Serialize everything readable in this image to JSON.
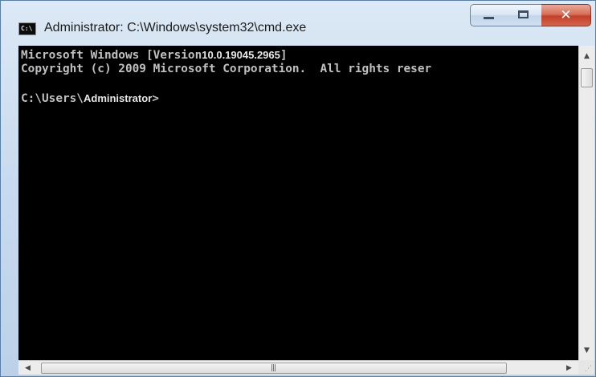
{
  "window": {
    "title": "Administrator: C:\\Windows\\system32\\cmd.exe",
    "icon_label": "C:\\",
    "buttons": {
      "minimize": "minimize-icon",
      "maximize": "maximize-icon",
      "close_glyph": "✕"
    }
  },
  "console": {
    "line1_prefix": "Microsoft Windows [Version",
    "line1_version": "10.0.19045.2965",
    "line1_suffix": "]",
    "line2": "Copyright (c) 2009 Microsoft Corporation.  All rights reser",
    "prompt_path": "C:\\Users\\",
    "prompt_user": "Administrator",
    "prompt_suffix": ">"
  },
  "scrollbars": {
    "up_arrow": "▲",
    "down_arrow": "▼",
    "left_arrow": "◀",
    "right_arrow": "▶",
    "grip": "|||",
    "size_grip": "⋰"
  },
  "colors": {
    "console_bg": "#000000",
    "console_text": "#c0c0c0",
    "close_button": "#c2412a"
  }
}
